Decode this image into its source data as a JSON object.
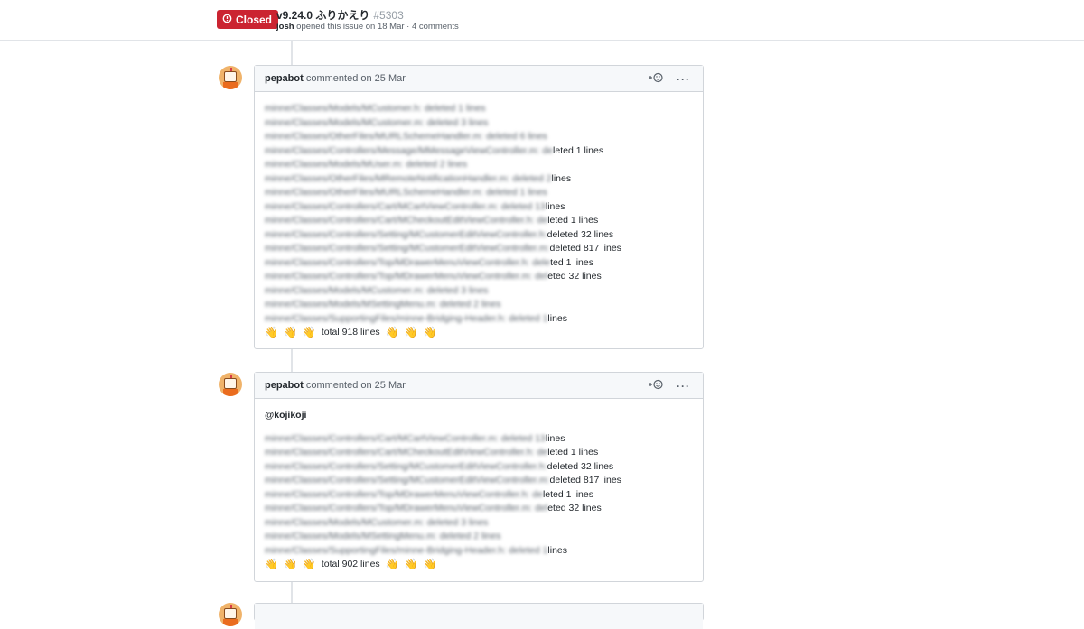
{
  "issue": {
    "status": "Closed",
    "title": "v9.24.0 ふりかえり",
    "number": "#5303",
    "author": "josh",
    "meta_rest": "opened this issue on 18 Mar · 4 comments"
  },
  "comments": [
    {
      "author": "pepabot",
      "date": "commented on 25 Mar",
      "mention": "",
      "lines": [
        {
          "path": "minne/Classes/Models/MCustomer.h: deleted 1 lines",
          "visible": ""
        },
        {
          "path": "minne/Classes/Models/MCustomer.m: deleted 3 lines",
          "visible": ""
        },
        {
          "path": "minne/Classes/OtherFiles/MURLSchemeHandler.m: deleted 6 lines",
          "visible": ""
        },
        {
          "path": "minne/Classes/Controllers/Message/MMessageViewController.m: de",
          "visible": "leted 1 lines"
        },
        {
          "path": "minne/Classes/Models/MUser.m: deleted 2 lines",
          "visible": ""
        },
        {
          "path": "minne/Classes/OtherFiles/MRemoteNotificationHandler.m: deleted 2",
          "visible": " lines"
        },
        {
          "path": "minne/Classes/OtherFiles/MURLSchemeHandler.m: deleted 1 lines",
          "visible": ""
        },
        {
          "path": "minne/Classes/Controllers/Cart/MCartViewController.m: deleted 13",
          "visible": "lines"
        },
        {
          "path": "minne/Classes/Controllers/Cart/MCheckoutEditViewController.h: de",
          "visible": "leted 1 lines"
        },
        {
          "path": "minne/Classes/Controllers/Setting/MCustomerEditViewController.h:",
          "visible": " deleted 32 lines"
        },
        {
          "path": "minne/Classes/Controllers/Setting/MCustomerEditViewController.m:",
          "visible": " deleted 817 lines"
        },
        {
          "path": "minne/Classes/Controllers/Top/MDrawerMenuViewController.h: dele",
          "visible": "ted 1 lines"
        },
        {
          "path": "minne/Classes/Controllers/Top/MDrawerMenuViewController.m: del",
          "visible": "eted 32 lines"
        },
        {
          "path": "minne/Classes/Models/MCustomer.m: deleted 3 lines",
          "visible": ""
        },
        {
          "path": "minne/Classes/Models/MSettingMenu.m: deleted 2 lines",
          "visible": ""
        },
        {
          "path": "minne/Classes/SupportingFiles/minne-Bridging-Header.h: deleted 1",
          "visible": "lines"
        }
      ],
      "total": "total 918 lines"
    },
    {
      "author": "pepabot",
      "date": "commented on 25 Mar",
      "mention": "@kojikoji",
      "lines": [
        {
          "path": "minne/Classes/Controllers/Cart/MCartViewController.m: deleted 13",
          "visible": "lines"
        },
        {
          "path": "minne/Classes/Controllers/Cart/MCheckoutEditViewController.h: de",
          "visible": "leted 1 lines"
        },
        {
          "path": "minne/Classes/Controllers/Setting/MCustomerEditViewController.h:",
          "visible": " deleted 32 lines"
        },
        {
          "path": "minne/Classes/Controllers/Setting/MCustomerEditViewController.m:",
          "visible": " deleted 817 lines"
        },
        {
          "path": "minne/Classes/Controllers/Top/MDrawerMenuViewController.h: de",
          "visible": "leted 1 lines"
        },
        {
          "path": "minne/Classes/Controllers/Top/MDrawerMenuViewController.m: del",
          "visible": "eted 32 lines"
        },
        {
          "path": "minne/Classes/Models/MCustomer.m: deleted 3 lines",
          "visible": ""
        },
        {
          "path": "minne/Classes/Models/MSettingMenu.m: deleted 2 lines",
          "visible": ""
        },
        {
          "path": "minne/Classes/SupportingFiles/minne-Bridging-Header.h: deleted 1",
          "visible": "lines"
        }
      ],
      "total": "total 902 lines"
    }
  ],
  "colors": {
    "closed": "#cb2431",
    "border": "#d1d5da",
    "header_bg": "#f6f8fa"
  },
  "icons": {
    "reaction": "smiley-plus-icon",
    "more": "kebab-icon",
    "wave": "👋",
    "closed": "issue-closed-icon"
  }
}
